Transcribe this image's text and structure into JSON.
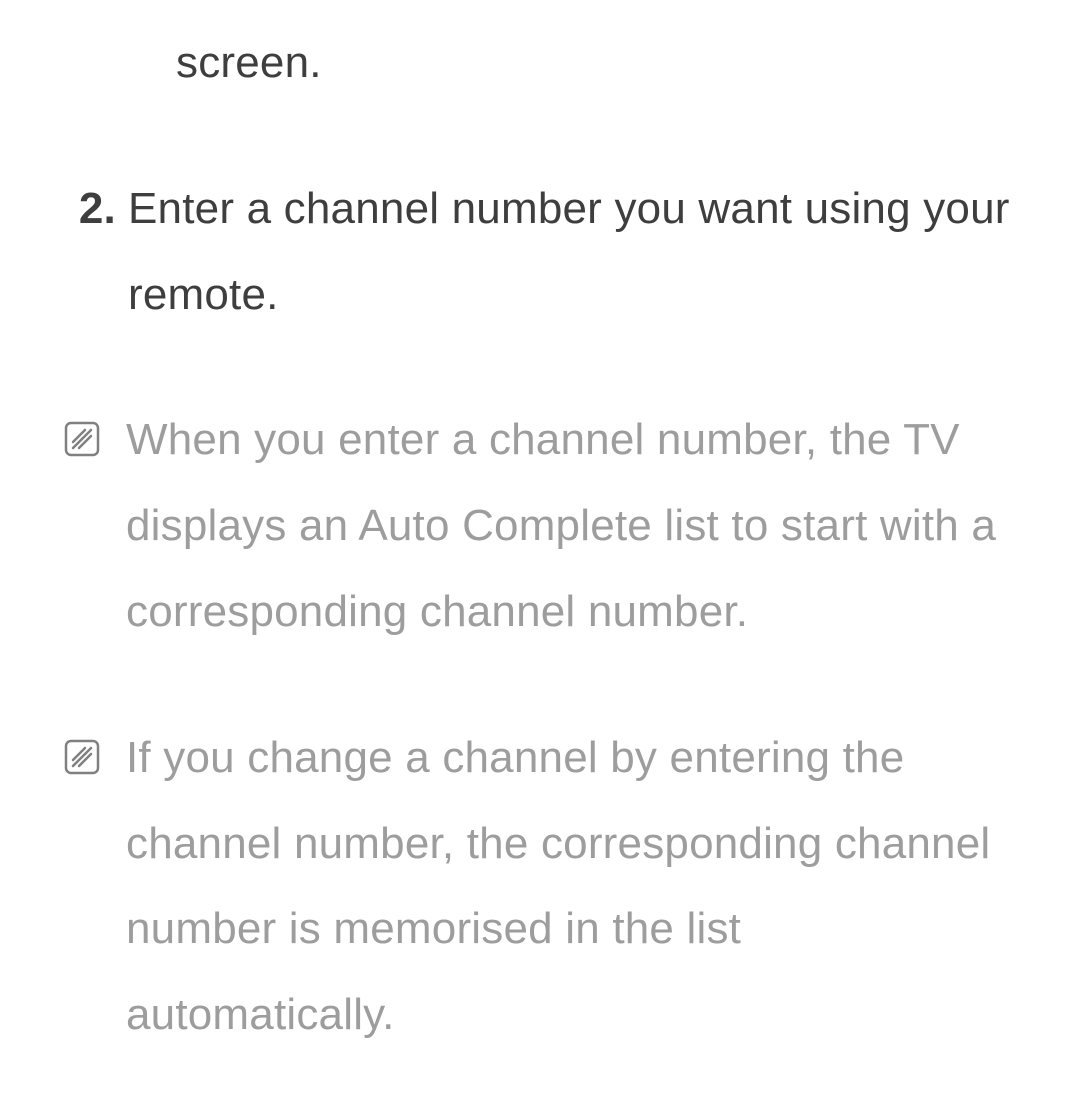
{
  "continuation": {
    "text": "screen."
  },
  "step": {
    "marker": "2.",
    "text": "Enter a channel number you want using your remote."
  },
  "notes": [
    {
      "text": "When you enter a channel number, the TV displays an Auto Complete list to start with a corresponding channel number."
    },
    {
      "text": "If you change a channel by entering the channel number, the corresponding channel number is memorised in the list automatically."
    }
  ],
  "colors": {
    "body_text": "#3e3e3e",
    "note_text": "#9d9d9d",
    "icon_stroke": "#808080"
  }
}
